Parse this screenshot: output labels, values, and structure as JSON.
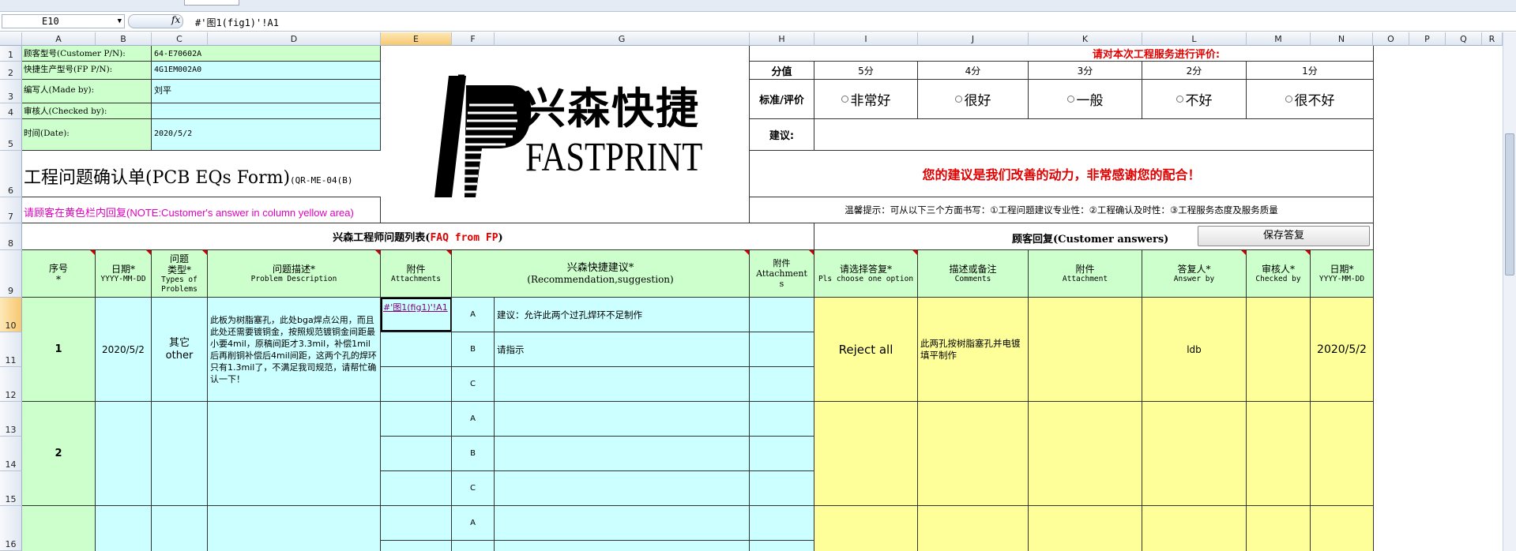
{
  "formula_bar": {
    "name_box": "E10",
    "fx": "fx",
    "formula": "#'图1(fig1)'!A1"
  },
  "columns": [
    "A",
    "B",
    "C",
    "D",
    "E",
    "F",
    "G",
    "H",
    "I",
    "J",
    "K",
    "L",
    "M",
    "N",
    "O",
    "P",
    "Q",
    "R"
  ],
  "rows": [
    "1",
    "2",
    "3",
    "4",
    "5",
    "6",
    "7",
    "8",
    "9",
    "10",
    "11",
    "12",
    "13",
    "14",
    "15",
    "16"
  ],
  "header_fields": {
    "customer_pn_label": "顾客型号(Customer P/N):",
    "customer_pn_value": "64-E70602A",
    "fp_pn_label": "快捷生产型号(FP P/N):",
    "fp_pn_value": "4G1EM002A0",
    "made_by_label": "编写人(Made by):",
    "made_by_value": "刘平",
    "checked_by_label": "审核人(Checked by):",
    "checked_by_value": "",
    "date_label": "时间(Date):",
    "date_value": "2020/5/2"
  },
  "logo": {
    "chinese": "兴森快捷",
    "english": "FASTPRINT"
  },
  "form_title": {
    "title_main": "工程问题确认单(PCB EQs Form)",
    "title_code": "(QR-ME-04(B)",
    "note": "请顾客在黄色栏内回复(NOTE:Customer's answer in column yellow area)"
  },
  "rating": {
    "heading": "请对本次工程服务进行评价:",
    "score_label": "分值",
    "scores": [
      "5分",
      "4分",
      "3分",
      "2分",
      "1分"
    ],
    "criteria_label": "标准/评价",
    "options": [
      "非常好",
      "很好",
      "一般",
      "不好",
      "很不好"
    ],
    "suggestion_label": "建议:",
    "thanks": "您的建议是我们改善的动力，非常感谢您的配合！",
    "tips": "温馨提示：可从以下三个方面书写：①工程问题建议专业性：②工程确认及时性：③工程服务态度及服务质量",
    "accent_color": "#e00000"
  },
  "section_headers": {
    "faq_prefix": "兴森工程师问题列表(",
    "faq_en": "FAQ from FP",
    "faq_suffix": ")",
    "customer_answers": "顾客回复(Customer answers)",
    "save_button": "保存答复"
  },
  "table_headers": {
    "seq": "序号\n*",
    "date": "日期*",
    "date_sub": "YYYY-MM-DD",
    "type": "问题\n类型*",
    "type_sub": "Types of\nProblems",
    "desc": "问题描述*",
    "desc_sub": "Problem Description",
    "attach": "附件",
    "attach_sub": "Attachments",
    "recommend": "兴森快捷建议*",
    "recommend_sub": "(Recommendation,suggestion)",
    "attach2": "附件\nAttachment\ns",
    "choose": "请选择答复*",
    "choose_sub": "Pls choose one option",
    "comments": "描述或备注",
    "comments_sub": "Comments",
    "attachment": "附件",
    "attachment_sub": "Attachment",
    "answer_by": "答复人*",
    "answer_by_sub": "Answer by",
    "checked_by": "审核人*",
    "checked_by_sub": "Checked by",
    "answer_date": "日期*",
    "answer_date_sub": "YYYY-MM-DD"
  },
  "problems": [
    {
      "seq": "1",
      "date": "2020/5/2",
      "type": "其它\nother",
      "description": "此板为树脂塞孔，此处bga焊点公用，而且此处还需要镀铜金，按照规范镀铜金间距最小要4mil，原稿间距才3.3mil，补偿1mil后再削铜补偿后4mil间距，这两个孔的焊环只有1.3mil了，不满足我司规范，请帮忙确认一下！",
      "attachment_link": "#'图1(fig1)'!A1",
      "options": [
        {
          "letter": "A",
          "text": "建议：允许此两个过孔焊环不足制作"
        },
        {
          "letter": "B",
          "text": "请指示"
        },
        {
          "letter": "C",
          "text": ""
        }
      ],
      "answer": "Reject all",
      "comments": "此两孔按树脂塞孔并电镀填平制作",
      "answer_by": "ldb",
      "checked_by": "",
      "answer_date": "2020/5/2"
    },
    {
      "seq": "2",
      "options": [
        {
          "letter": "A",
          "text": ""
        },
        {
          "letter": "B",
          "text": ""
        },
        {
          "letter": "C",
          "text": ""
        }
      ]
    },
    {
      "seq": "",
      "options": [
        {
          "letter": "A",
          "text": ""
        }
      ]
    }
  ]
}
